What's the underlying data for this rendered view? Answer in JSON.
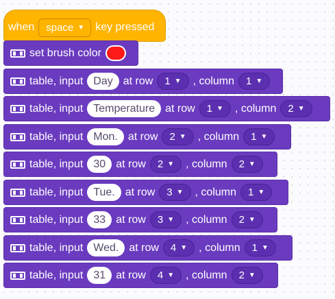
{
  "hat": {
    "when": "when",
    "key": "space",
    "pressed": "key pressed"
  },
  "brush": {
    "label": "set brush color",
    "color": "#ff1a1a"
  },
  "rows": [
    {
      "prefix": "table, input",
      "value": "Day",
      "at_row": "at row",
      "row": "1",
      "column_label": ", column",
      "column": "1"
    },
    {
      "prefix": "table, input",
      "value": "Temperature",
      "at_row": "at row",
      "row": "1",
      "column_label": ", column",
      "column": "2"
    },
    {
      "prefix": "table, input",
      "value": "Mon.",
      "at_row": "at row",
      "row": "2",
      "column_label": ", column",
      "column": "1"
    },
    {
      "prefix": "table, input",
      "value": "30",
      "at_row": "at row",
      "row": "2",
      "column_label": ", column",
      "column": "2"
    },
    {
      "prefix": "table, input",
      "value": "Tue.",
      "at_row": "at row",
      "row": "3",
      "column_label": ", column",
      "column": "1"
    },
    {
      "prefix": "table, input",
      "value": "33",
      "at_row": "at row",
      "row": "3",
      "column_label": ", column",
      "column": "2"
    },
    {
      "prefix": "table, input",
      "value": "Wed.",
      "at_row": "at row",
      "row": "4",
      "column_label": ", column",
      "column": "1"
    },
    {
      "prefix": "table, input",
      "value": "31",
      "at_row": "at row",
      "row": "4",
      "column_label": ", column",
      "column": "2"
    }
  ]
}
